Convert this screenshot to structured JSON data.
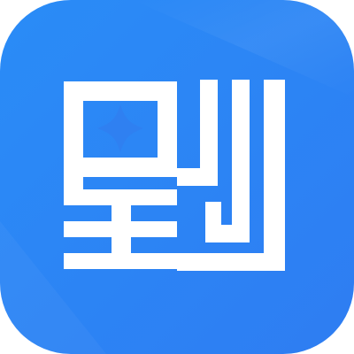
{
  "app_icon": {
    "icon_name": "stylized-glyph-with-sparkle-icon",
    "colors": {
      "gradient_start": "#2A8CF7",
      "gradient_end": "#2E7DF2",
      "glyph": "#FFFFFF",
      "sparkle": "#2F80F1"
    }
  }
}
